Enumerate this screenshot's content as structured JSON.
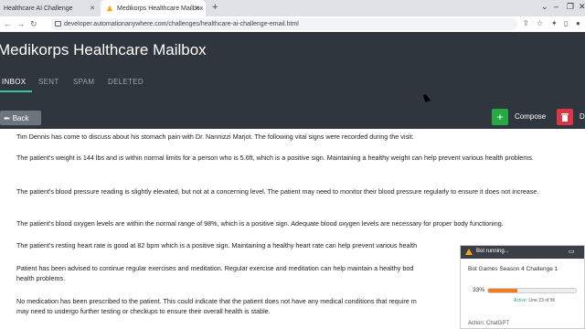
{
  "browser": {
    "tabs": [
      {
        "label": "Healthcare AI Challenge"
      },
      {
        "label": "Medikorps Healthcare Mailbox"
      }
    ],
    "url": "developer.automationanywhere.com/challenges/healthcare-ai-challenge-email.html"
  },
  "app": {
    "title": "Medikorps Healthcare Mailbox",
    "tabs": [
      "INBOX",
      "SENT",
      "SPAM",
      "DELETED"
    ],
    "back_label": "Back",
    "compose_label": "Compose",
    "delete_label": "D"
  },
  "message": {
    "paragraphs": [
      "Tim Dennis has come to discuss about his stomach pain with Dr. Nannizzi Marjot. The following vital signs were recorded during the visit:",
      "The patient's weight is 144 lbs and is within normal limits for a person who is 5.6ft, which is a positive sign. Maintaining a healthy weight can help prevent various health problems.",
      "The patient's blood pressure reading is slightly elevated, but not at a concerning level. The patient may need to monitor their blood pressure regularly to ensure it does not increase.",
      "The patient's blood oxygen levels are within the normal range of 98%, which is a positive sign. Adequate blood oxygen levels are necessary for proper body functioning.",
      "The patient's resting heart rate is good at 82 bpm which is a positive sign. Maintaining a healthy heart rate can help prevent various health",
      "Patient has been advised to continue regular exercises and meditation. Regular exercise and meditation can help maintain a healthy bod",
      "health problems.",
      "No medication has been prescribed to the patient. This could indicate that the patient does not have any medical conditions that require m",
      "may need to undergo further testing or checkups to ensure their overall health is stable."
    ]
  },
  "bot": {
    "header": "Bot running...",
    "task": "Bot Games Season 4 Challenge 1",
    "percent_label": "33%",
    "progress": 0.33,
    "status_prefix": "Active:",
    "status_line": "Line 23 of 96",
    "action": "Action: ChatGPT"
  },
  "colors": {
    "app_bg": "#30363d",
    "accent": "#3ac29b",
    "compose": "#28a745",
    "delete": "#dc3545",
    "progress": "#f07c1a"
  }
}
